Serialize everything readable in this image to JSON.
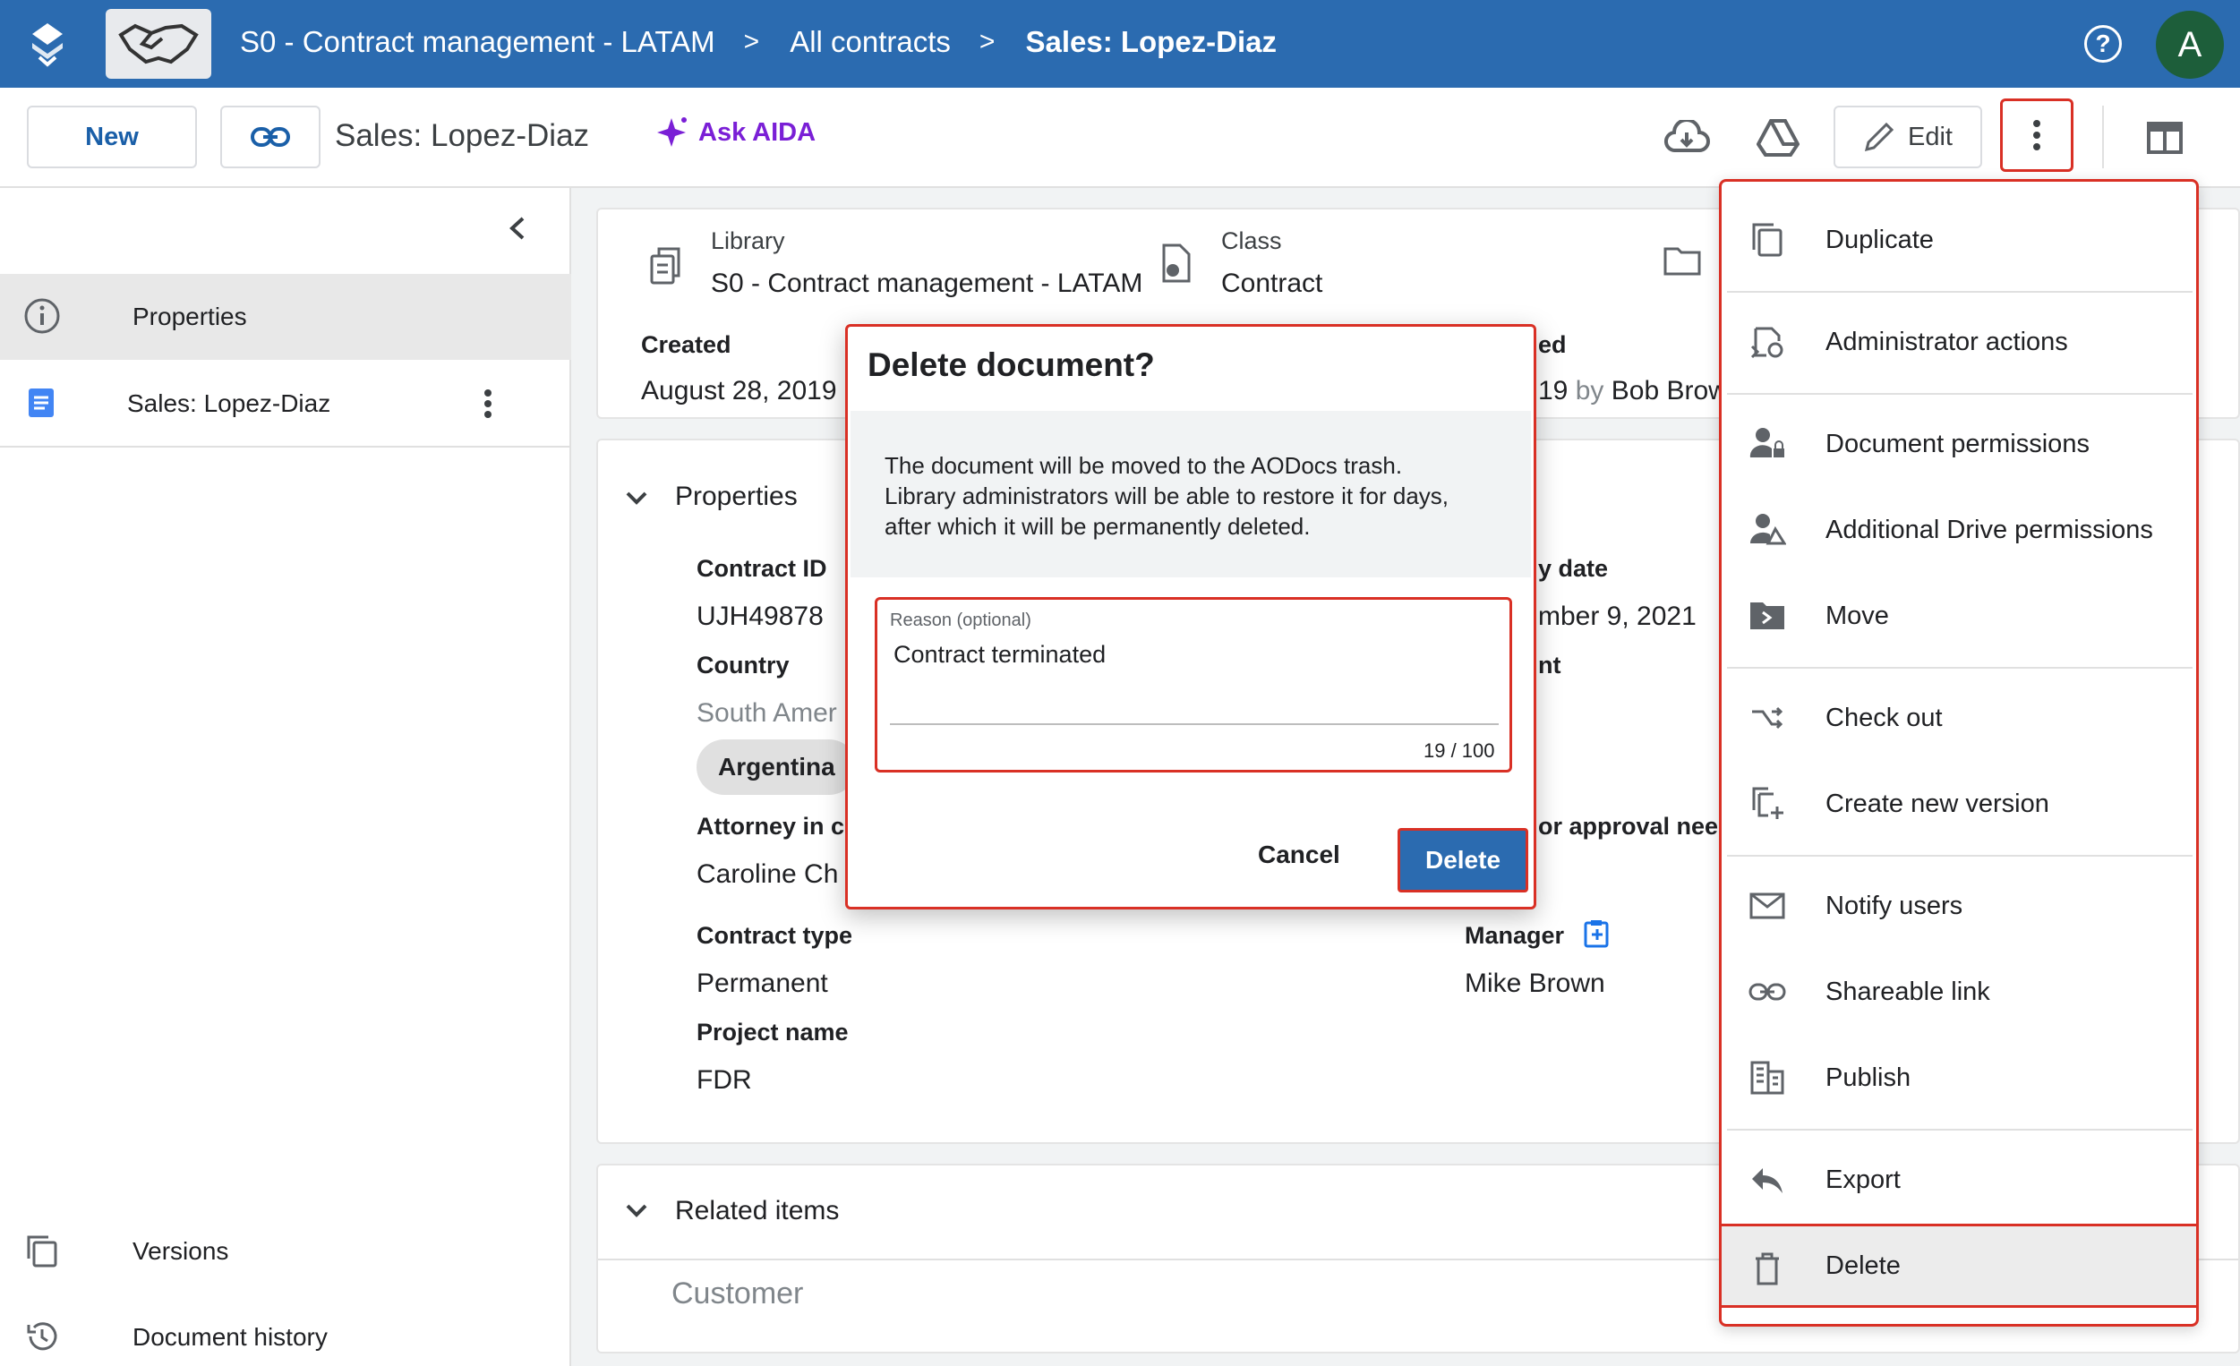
{
  "topbar": {
    "breadcrumbs": [
      "S0 - Contract management - LATAM",
      "All contracts",
      "Sales: Lopez-Diaz"
    ],
    "separator": ">",
    "help_glyph": "?",
    "avatar_initial": "A"
  },
  "toolbar": {
    "new_label": "New",
    "doc_title": "Sales: Lopez-Diaz",
    "ask_aida_label": "Ask AIDA",
    "edit_label": "Edit"
  },
  "sidebar": {
    "items": [
      {
        "label": "Properties",
        "icon": "info-icon"
      },
      {
        "label": "Sales: Lopez-Diaz",
        "icon": "document-icon"
      }
    ],
    "bottom_items": [
      {
        "label": "Versions",
        "icon": "versions-icon"
      },
      {
        "label": "Document history",
        "icon": "history-icon"
      }
    ]
  },
  "info": {
    "library_label": "Library",
    "library_value": "S0 - Contract management - LATAM",
    "class_label": "Class",
    "class_value": "Contract",
    "created_label": "Created",
    "created_value": "August 28, 2019",
    "modified_label_partial": "ed",
    "modified_value_partial": "19",
    "modified_by": "by",
    "modified_user": "Bob Brow"
  },
  "properties": {
    "section_title": "Properties",
    "contract_id_label": "Contract ID",
    "contract_id_value": "UJH49878",
    "date_label_partial": "y date",
    "date_value_partial": "mber 9, 2021",
    "country_label": "Country",
    "country_value": "South Amer",
    "country_chip": "Argentina",
    "nt_label_partial": "nt",
    "attorney_label": "Attorney in cl",
    "attorney_value": "Caroline Ch",
    "approval_label_partial": "or approval need",
    "contract_type_label": "Contract type",
    "contract_type_value": "Permanent",
    "manager_label": "Manager",
    "manager_value": "Mike Brown",
    "project_label": "Project name",
    "project_value": "FDR"
  },
  "related": {
    "section_title": "Related items",
    "customer_label": "Customer"
  },
  "menu": {
    "items": [
      {
        "label": "Duplicate",
        "icon": "duplicate-icon"
      },
      {
        "label": "Administrator actions",
        "icon": "admin-actions-icon"
      },
      {
        "label": "Document permissions",
        "icon": "person-lock-icon"
      },
      {
        "label": "Additional Drive permissions",
        "icon": "person-drive-icon"
      },
      {
        "label": "Move",
        "icon": "move-folder-icon"
      },
      {
        "label": "Check out",
        "icon": "check-out-icon"
      },
      {
        "label": "Create new version",
        "icon": "new-version-icon"
      },
      {
        "label": "Notify users",
        "icon": "mail-icon"
      },
      {
        "label": "Shareable link",
        "icon": "link-icon"
      },
      {
        "label": "Publish",
        "icon": "publish-icon"
      },
      {
        "label": "Export",
        "icon": "export-icon"
      },
      {
        "label": "Delete",
        "icon": "trash-icon"
      }
    ]
  },
  "modal": {
    "title": "Delete document?",
    "body_line1": "The document will be moved to the AODocs trash.",
    "body_line2": "Library administrators will be able to restore it for days,",
    "body_line3": "after which it will be permanently deleted.",
    "reason_label": "Reason (optional)",
    "reason_value": "Contract terminated",
    "char_count": "19 / 100",
    "cancel_label": "Cancel",
    "delete_label": "Delete"
  },
  "colors": {
    "topbar": "#2b6bb0",
    "accent": "#1a5fa8",
    "aida": "#7a1fd6",
    "highlight": "#d93025"
  }
}
